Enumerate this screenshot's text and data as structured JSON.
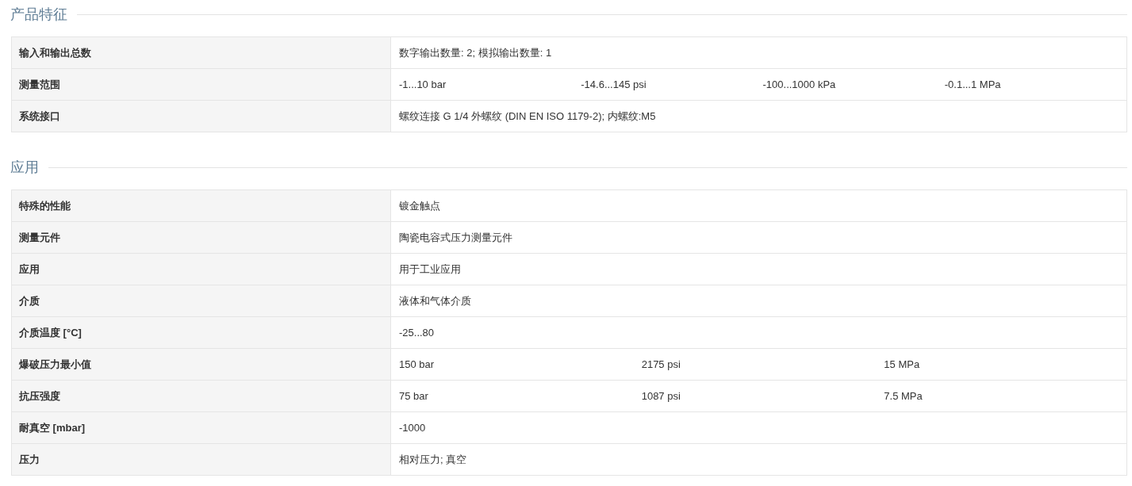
{
  "sections": [
    {
      "title": "产品特征",
      "rows": [
        {
          "label": "输入和输出总数",
          "values": [
            "数字输出数量: 2; 模拟输出数量: 1"
          ]
        },
        {
          "label": "测量范围",
          "values": [
            "-1...10 bar",
            "-14.6...145 psi",
            "-100...1000 kPa",
            "-0.1...1 MPa"
          ]
        },
        {
          "label": "系统接口",
          "values": [
            "螺纹连接 G 1/4 外螺纹 (DIN EN ISO 1179-2); 内螺纹:M5"
          ]
        }
      ]
    },
    {
      "title": "应用",
      "rows": [
        {
          "label": "特殊的性能",
          "values": [
            "镀金触点"
          ]
        },
        {
          "label": "测量元件",
          "values": [
            "陶瓷电容式压力测量元件"
          ]
        },
        {
          "label": "应用",
          "values": [
            "用于工业应用"
          ]
        },
        {
          "label": "介质",
          "values": [
            "液体和气体介质"
          ]
        },
        {
          "label": "介质温度 [°C]",
          "values": [
            "-25...80"
          ]
        },
        {
          "label": "爆破压力最小值",
          "values": [
            "150 bar",
            "2175 psi",
            "15 MPa"
          ]
        },
        {
          "label": "抗压强度",
          "values": [
            "75 bar",
            "1087 psi",
            "7.5 MPa"
          ]
        },
        {
          "label": "耐真空 [mbar]",
          "values": [
            "-1000"
          ]
        },
        {
          "label": "压力",
          "values": [
            "相对压力; 真空"
          ]
        }
      ]
    }
  ]
}
